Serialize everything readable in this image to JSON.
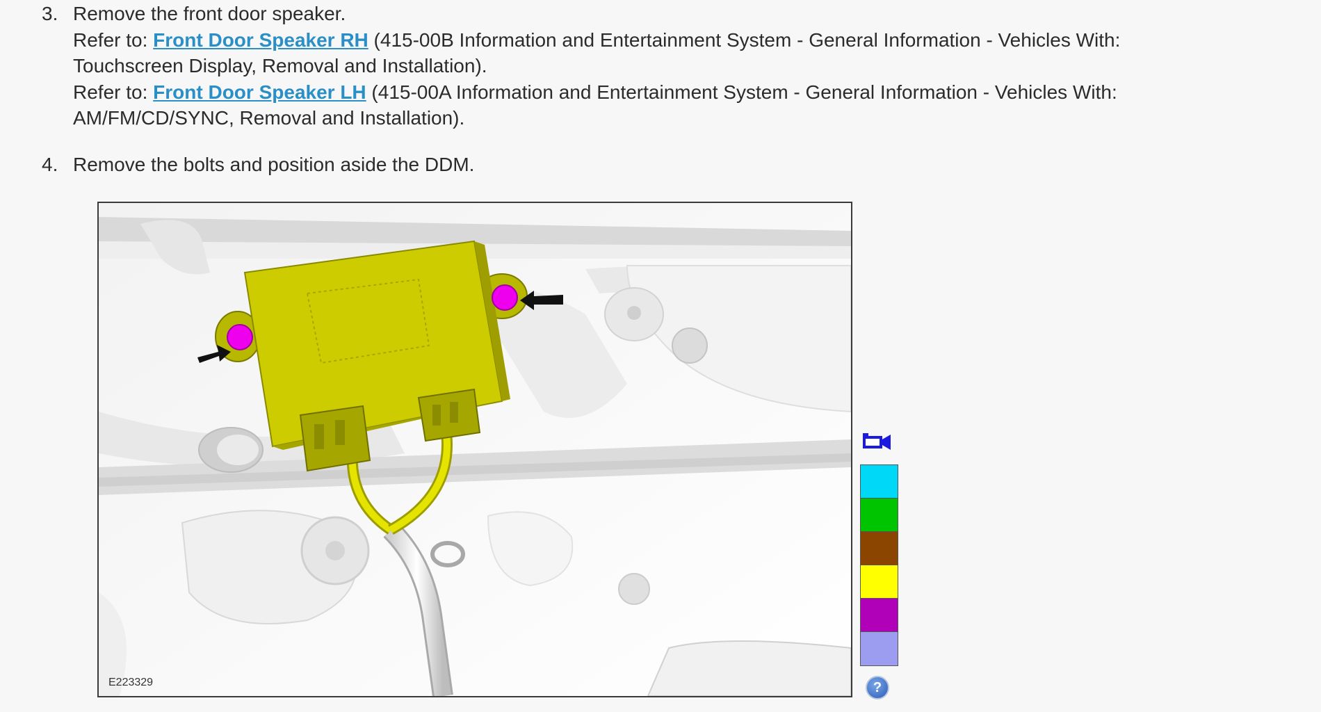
{
  "steps": [
    {
      "number": "3.",
      "title": "Remove the front door speaker.",
      "refs": [
        {
          "prefix": "Refer to: ",
          "link": "Front Door Speaker RH",
          "suffix_line1": " (415-00B Information and Entertainment System - General Information - Vehicles With:",
          "suffix_line2": "Touchscreen Display, Removal and Installation)."
        },
        {
          "prefix": "Refer to: ",
          "link": "Front Door Speaker LH",
          "suffix_line1": " (415-00A Information and Entertainment System - General Information - Vehicles With:",
          "suffix_line2": "AM/FM/CD/SYNC, Removal and Installation)."
        }
      ]
    },
    {
      "number": "4.",
      "title": "Remove the bolts and position aside the DDM."
    }
  ],
  "figure": {
    "id_label": "E223329"
  },
  "colors": {
    "link": "#2a8fc7",
    "module": "#cccc00",
    "bolt": "#ee00ee",
    "harness": "#e4e400",
    "swatches": [
      "#00d8f8",
      "#00c400",
      "#8b4500",
      "#ffff00",
      "#b000b8",
      "#9c9cf0"
    ]
  },
  "icons": {
    "camera": "camera-icon",
    "help": "help-icon"
  },
  "help_label": "?"
}
